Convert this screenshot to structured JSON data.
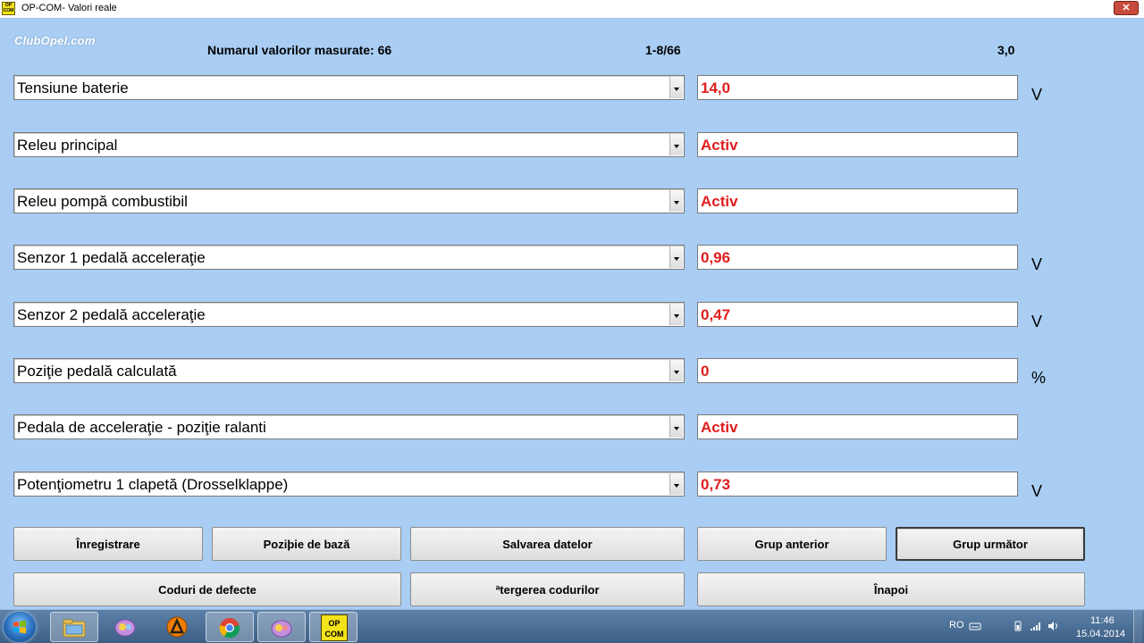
{
  "window": {
    "icon_text": "OP COM",
    "title": "OP-COM- Valori reale",
    "close_label": "✕"
  },
  "watermark": "ClubOpel.com",
  "header": {
    "count_label": "Numarul valorilor masurate: 66",
    "pager": "1-8/66",
    "version": "3,0"
  },
  "rows": [
    {
      "label": "Tensiune baterie",
      "value": "14,0",
      "unit": "V"
    },
    {
      "label": "Releu principal",
      "value": "Activ",
      "unit": ""
    },
    {
      "label": "Releu pompă combustibil",
      "value": "Activ",
      "unit": ""
    },
    {
      "label": "Senzor 1 pedală acceleraţie",
      "value": "0,96",
      "unit": "V"
    },
    {
      "label": "Senzor 2 pedală acceleraţie",
      "value": "0,47",
      "unit": "V"
    },
    {
      "label": "Poziţie pedală calculată",
      "value": "0",
      "unit": "%"
    },
    {
      "label": "Pedala de acceleraţie - poziţie ralanti",
      "value": "Activ",
      "unit": ""
    },
    {
      "label": "Potenţiometru 1 clapetă (Drosselklappe)",
      "value": "0,73",
      "unit": "V"
    }
  ],
  "buttons": {
    "record": "Înregistrare",
    "base_position": "Poziþie de bază",
    "save_data": "Salvarea datelor",
    "prev_group": "Grup anterior",
    "next_group": "Grup următor",
    "fault_codes": "Coduri de defecte",
    "clear_codes": "ªtergerea codurilor",
    "back": "Înapoi"
  },
  "taskbar": {
    "items": [
      "start-button",
      "file-explorer",
      "messenger",
      "avast",
      "chrome",
      "messenger-2",
      "op-com"
    ],
    "opcom_icon_text": "OP COM",
    "language": "RO",
    "time": "11:46",
    "date": "15.04.2014"
  },
  "colors": {
    "background": "#a9cdf3",
    "value_text": "#e01d1d",
    "taskbar": "#3d5f86"
  }
}
